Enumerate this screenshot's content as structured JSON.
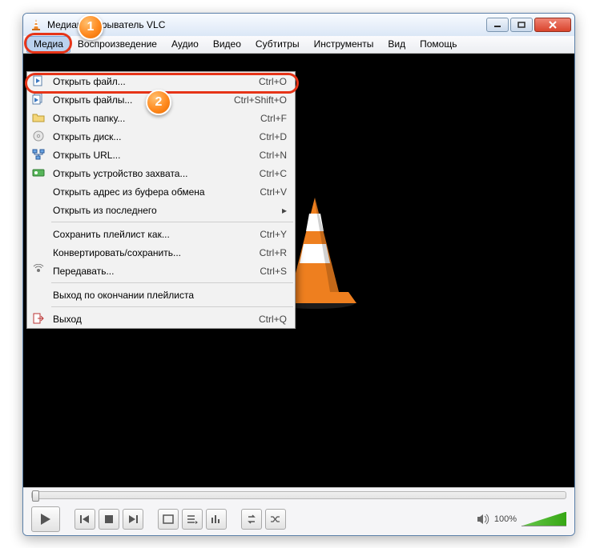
{
  "window": {
    "title": "Медиапроигрыватель VLC"
  },
  "menubar": [
    "Медиа",
    "Воспроизведение",
    "Аудио",
    "Видео",
    "Субтитры",
    "Инструменты",
    "Вид",
    "Помощь"
  ],
  "menu_open_index": 0,
  "media_menu": {
    "groups": [
      [
        {
          "icon": "file-play",
          "label": "Открыть файл...",
          "shortcut": "Ctrl+O"
        },
        {
          "icon": "files-play",
          "label": "Открыть файлы...",
          "shortcut": "Ctrl+Shift+O"
        },
        {
          "icon": "folder",
          "label": "Открыть папку...",
          "shortcut": "Ctrl+F"
        },
        {
          "icon": "disc",
          "label": "Открыть диск...",
          "shortcut": "Ctrl+D"
        },
        {
          "icon": "network",
          "label": "Открыть URL...",
          "shortcut": "Ctrl+N"
        },
        {
          "icon": "capture",
          "label": "Открыть устройство захвата...",
          "shortcut": "Ctrl+C"
        },
        {
          "icon": "",
          "label": "Открыть адрес из буфера обмена",
          "shortcut": "Ctrl+V"
        },
        {
          "icon": "",
          "label": "Открыть из последнего",
          "submenu": true
        }
      ],
      [
        {
          "icon": "",
          "label": "Сохранить плейлист как...",
          "shortcut": "Ctrl+Y"
        },
        {
          "icon": "",
          "label": "Конвертировать/сохранить...",
          "shortcut": "Ctrl+R"
        },
        {
          "icon": "stream",
          "label": "Передавать...",
          "shortcut": "Ctrl+S"
        }
      ],
      [
        {
          "icon": "",
          "label": "Выход по окончании плейлиста"
        }
      ],
      [
        {
          "icon": "exit",
          "label": "Выход",
          "shortcut": "Ctrl+Q"
        }
      ]
    ]
  },
  "marker1": "1",
  "marker2": "2",
  "volume_pct": "100%",
  "control_icons": [
    "play",
    "prev",
    "stop",
    "next",
    "fullscreen",
    "playlist",
    "equalizer",
    "loop",
    "shuffle"
  ]
}
